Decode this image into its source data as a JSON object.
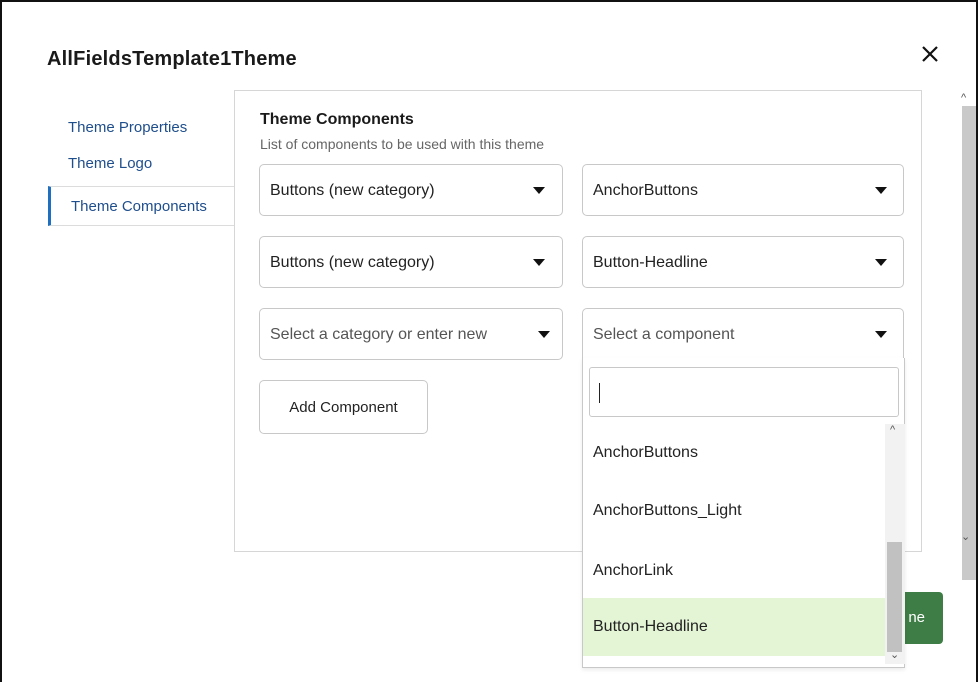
{
  "dialog": {
    "title": "AllFieldsTemplate1Theme"
  },
  "nav": {
    "items": [
      {
        "label": "Theme Properties"
      },
      {
        "label": "Theme Logo"
      },
      {
        "label": "Theme Components"
      }
    ],
    "active_index": 2
  },
  "panel": {
    "heading": "Theme Components",
    "subtitle": "List of components to be used with this theme",
    "rows": [
      {
        "category": "Buttons (new category)",
        "component": "AnchorButtons"
      },
      {
        "category": "Buttons (new category)",
        "component": "Button-Headline"
      },
      {
        "category_placeholder": "Select a category or enter new",
        "component_placeholder": "Select a component"
      }
    ],
    "add_button_label": "Add Component"
  },
  "footer": {
    "partial_button_label": "ne"
  },
  "dropdown": {
    "search_value": "",
    "options": [
      "AnchorButtons",
      "AnchorButtons_Light",
      "AnchorLink",
      "Button-Headline"
    ],
    "highlighted": "Button-Headline"
  },
  "colors": {
    "accent": "#1f6fc0",
    "nav_text": "#1f4e8c",
    "highlight": "#e4f5d6",
    "primary_button": "#3e7d46"
  }
}
